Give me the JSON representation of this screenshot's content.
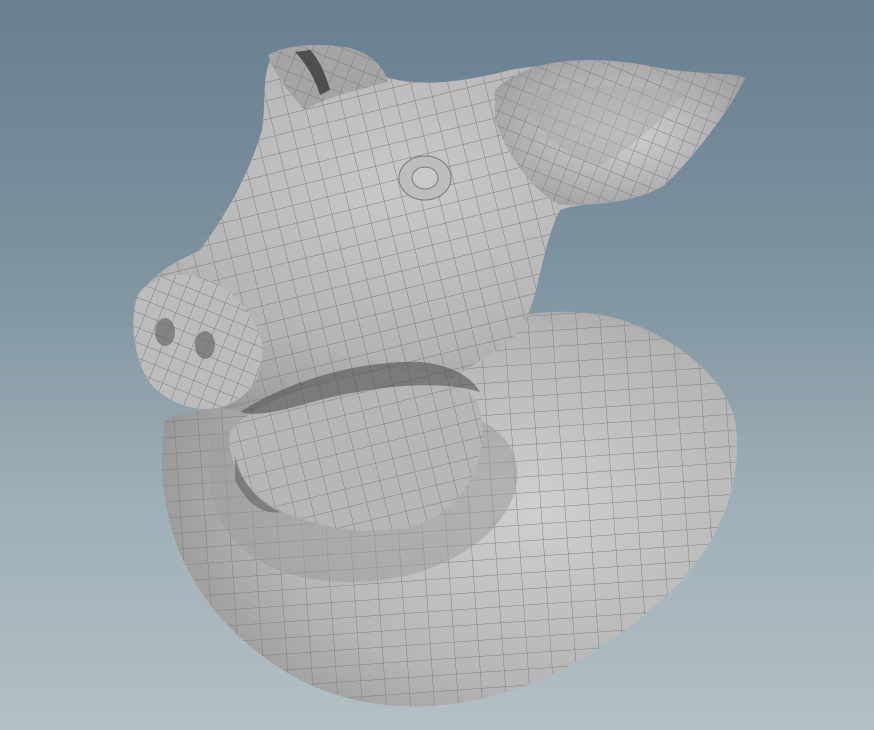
{
  "viewport": {
    "background_top": "#677f8f",
    "background_bottom": "#b3c0c4",
    "mesh_fill": "#b8b8b8",
    "wire_color": "#7a7a7a"
  },
  "model": {
    "icon": "pig-head-mesh-icon"
  }
}
